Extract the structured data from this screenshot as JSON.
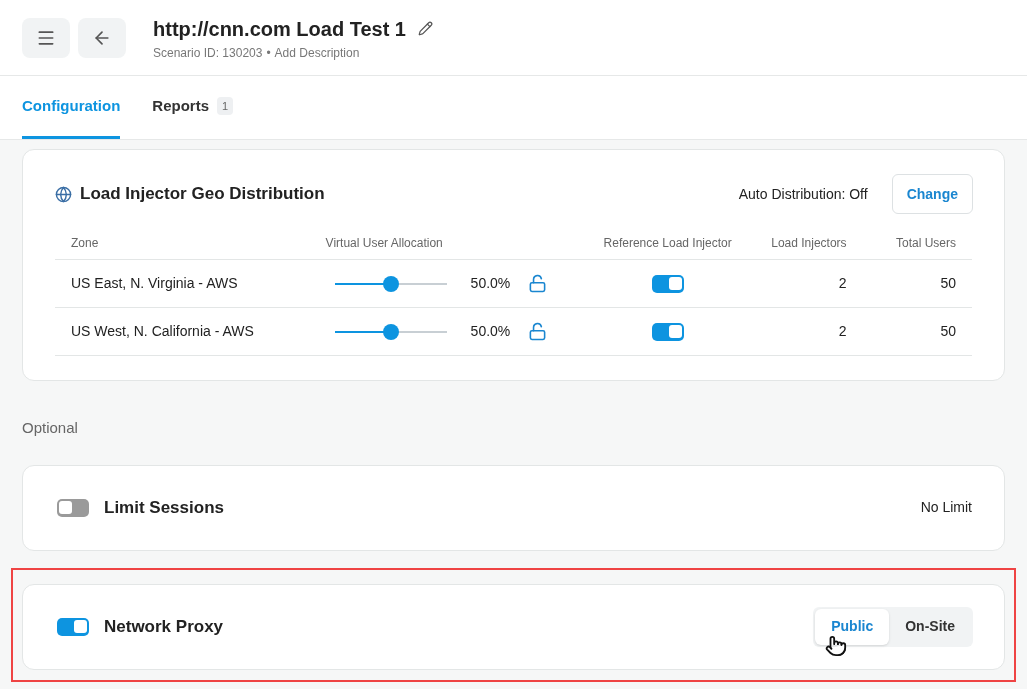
{
  "header": {
    "title": "http://cnn.com Load Test 1",
    "scenario_id": "Scenario ID: 130203",
    "separator": "•",
    "add_description": "Add Description"
  },
  "tabs": [
    {
      "label": "Configuration",
      "selected": true
    },
    {
      "label": "Reports",
      "selected": false,
      "count": "1"
    }
  ],
  "geo": {
    "title": "Load Injector Geo Distribution",
    "auto_distribution": "Auto Distribution: Off",
    "change_button": "Change",
    "columns": [
      "Zone",
      "Virtual User Allocation",
      "Reference Load Injector",
      "Load Injectors",
      "Total Users"
    ],
    "rows": [
      {
        "zone": "US East, N. Virginia - AWS",
        "level": 0.5,
        "percent": "50.0%",
        "locked": false,
        "reference": true,
        "injectors": "2",
        "users": "50"
      },
      {
        "zone": "US West, N. California - AWS",
        "level": 0.5,
        "percent": "50.0%",
        "locked": false,
        "reference": true,
        "injectors": "2",
        "users": "50"
      }
    ]
  },
  "optional_label": "Optional",
  "options": [
    {
      "kind": "value",
      "label": "Limit Sessions",
      "on": false,
      "value": "No Limit",
      "highlighted": false
    },
    {
      "kind": "segmented",
      "label": "Network Proxy",
      "on": true,
      "highlighted": true,
      "segments": [
        {
          "label": "Public",
          "selected": true
        },
        {
          "label": "On-Site",
          "selected": false
        }
      ]
    }
  ]
}
